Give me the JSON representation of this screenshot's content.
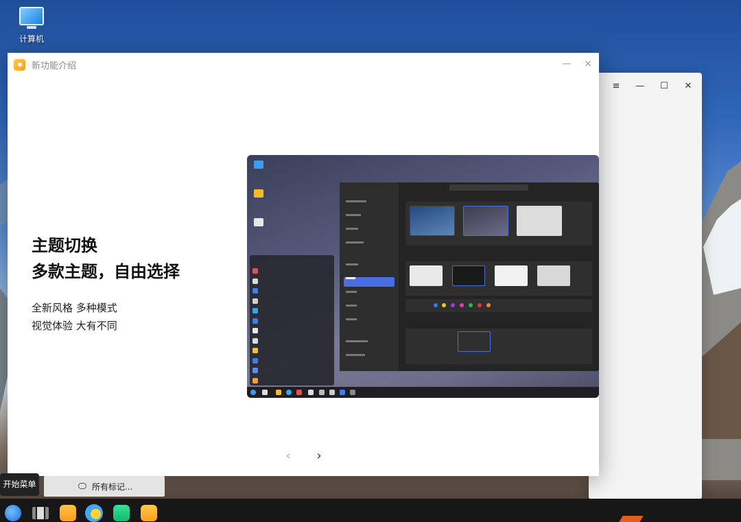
{
  "desktop": {
    "computer_icon_label": "计算机"
  },
  "dialog": {
    "title": "新功能介绍",
    "heading_line1": "主题切换",
    "heading_line2": "多款主题，自由选择",
    "sub_line1": "全新风格 多种模式",
    "sub_line2": "视觉体验 大有不同",
    "prev_glyph": "‹",
    "next_glyph": "›",
    "minimize_glyph": "—",
    "close_glyph": "×"
  },
  "background_window": {
    "menu_glyph": "≡",
    "minimize_glyph": "—",
    "maximize_glyph": "☐",
    "close_glyph": "✕"
  },
  "start_menu_tooltip": "开始菜单",
  "tag_bar_label": "所有标记...",
  "taskbar": {
    "items": [
      "start-menu-icon",
      "multitask-view-icon",
      "archive-icon",
      "browser-icon",
      "app-store-icon",
      "tips-icon"
    ]
  },
  "colors": {
    "accent": "#4a6ee0",
    "tips_orange": "#ffa928",
    "taskbar_bg": "#171717"
  }
}
